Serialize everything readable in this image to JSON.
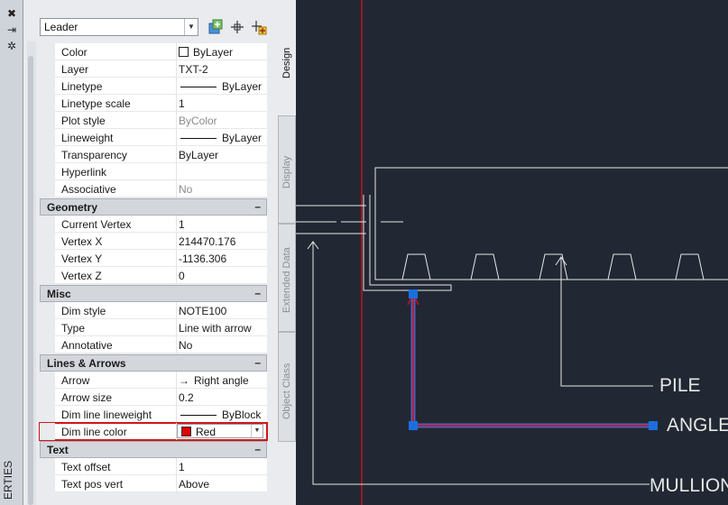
{
  "palette": {
    "title_fragment": "ERTIES",
    "object_type": "Leader",
    "tabs": [
      "Design",
      "Display",
      "Extended Data",
      "Object Class"
    ],
    "general_rows": [
      {
        "name": "Color",
        "value": "ByLayer",
        "kind": "swatch",
        "gray": false
      },
      {
        "name": "Layer",
        "value": "TXT-2",
        "kind": "text",
        "gray": false
      },
      {
        "name": "Linetype",
        "value": "ByLayer",
        "kind": "line",
        "gray": false
      },
      {
        "name": "Linetype scale",
        "value": "1",
        "kind": "text",
        "gray": false
      },
      {
        "name": "Plot style",
        "value": "ByColor",
        "kind": "text",
        "gray": true
      },
      {
        "name": "Lineweight",
        "value": "ByLayer",
        "kind": "line",
        "gray": false
      },
      {
        "name": "Transparency",
        "value": "ByLayer",
        "kind": "text",
        "gray": false
      },
      {
        "name": "Hyperlink",
        "value": "",
        "kind": "text",
        "gray": false
      },
      {
        "name": "Associative",
        "value": "No",
        "kind": "text",
        "gray": true
      }
    ],
    "sections": [
      {
        "title": "Geometry",
        "rows": [
          {
            "name": "Current Vertex",
            "value": "1",
            "kind": "text",
            "gray": false
          },
          {
            "name": "Vertex X",
            "value": "214470.176",
            "kind": "text",
            "gray": false
          },
          {
            "name": "Vertex Y",
            "value": "-1136.306",
            "kind": "text",
            "gray": false
          },
          {
            "name": "Vertex Z",
            "value": "0",
            "kind": "text",
            "gray": false
          }
        ]
      },
      {
        "title": "Misc",
        "rows": [
          {
            "name": "Dim style",
            "value": "NOTE100",
            "kind": "text",
            "gray": false
          },
          {
            "name": "Type",
            "value": "Line with arrow",
            "kind": "text",
            "gray": false
          },
          {
            "name": "Annotative",
            "value": "No",
            "kind": "text",
            "gray": false
          }
        ]
      },
      {
        "title": "Lines & Arrows",
        "rows": [
          {
            "name": "Arrow",
            "value": "Right angle",
            "kind": "arrow",
            "gray": false
          },
          {
            "name": "Arrow size",
            "value": "0.2",
            "kind": "text",
            "gray": false
          },
          {
            "name": "Dim line lineweight",
            "value": "ByBlock",
            "kind": "line",
            "gray": false
          },
          {
            "name": "Dim line color",
            "value": "Red",
            "kind": "dropdown",
            "gray": false,
            "highlight": true
          }
        ]
      },
      {
        "title": "Text",
        "rows": [
          {
            "name": "Text offset",
            "value": "1",
            "kind": "text",
            "gray": false
          },
          {
            "name": "Text pos vert",
            "value": "Above",
            "kind": "text",
            "gray": false
          }
        ]
      }
    ]
  },
  "drawing": {
    "labels": [
      "PILE",
      "ANGLE",
      "MULLION"
    ]
  },
  "colors": {
    "canvas": "#212833",
    "red_line": "#c0141e",
    "selection": "#1a6fe0",
    "leader_glow": "#5b62c6"
  }
}
